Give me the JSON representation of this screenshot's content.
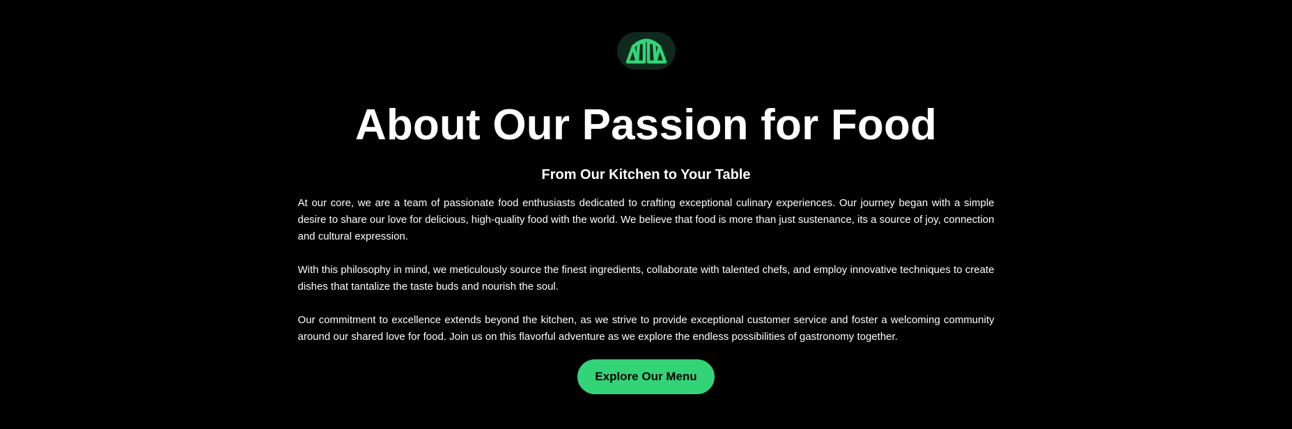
{
  "brand": {
    "logo_icon": "croissant-icon",
    "accent_color": "#33d477",
    "logo_badge_color": "#0f2a1c"
  },
  "about": {
    "title": "About Our Passion for Food",
    "subtitle": "From Our Kitchen to Your Table",
    "paragraphs": [
      "At our core, we are a team of passionate food enthusiasts dedicated to crafting exceptional culinary experiences. Our journey began with a simple desire to share our love for delicious, high-quality food with the world. We believe that food is more than just sustenance, its a source of joy, connection and cultural expression.",
      "With this philosophy in mind, we meticulously source the finest ingredients, collaborate with talented chefs, and employ innovative techniques to create dishes that tantalize the taste buds and nourish the soul.",
      "Our commitment to excellence extends beyond the kitchen, as we strive to provide exceptional customer service and foster a welcoming community around our shared love for food. Join us on this flavorful adventure as we explore the endless possibilities of gastronomy together."
    ],
    "cta_label": "Explore Our Menu"
  }
}
